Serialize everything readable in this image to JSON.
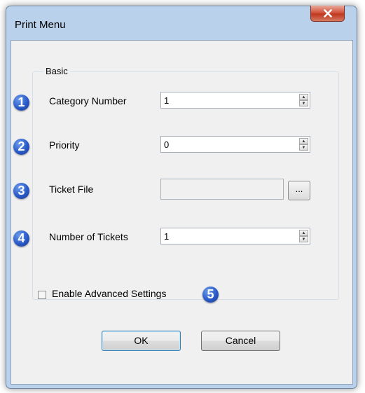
{
  "window": {
    "title": "Print Menu",
    "close_glyph": "X"
  },
  "group": {
    "label": "Basic"
  },
  "fields": {
    "category": {
      "badge": "1",
      "label": "Category Number",
      "value": "1"
    },
    "priority": {
      "badge": "2",
      "label": "Priority",
      "value": "0"
    },
    "ticket_file": {
      "badge": "3",
      "label": "Ticket File",
      "value": "",
      "browse_label": "..."
    },
    "num_tickets": {
      "badge": "4",
      "label": "Number of Tickets",
      "value": "1"
    }
  },
  "advanced": {
    "badge": "5",
    "label": "Enable Advanced Settings",
    "checked": false
  },
  "buttons": {
    "ok": "OK",
    "cancel": "Cancel"
  },
  "icons": {
    "badge": "numbered-circle-icon",
    "close": "close-x-icon",
    "spin": "spin-arrows-icon"
  },
  "colors": {
    "badge": "#2a5ac8",
    "close_button": "#c0381f",
    "frame": "#b9d1ea",
    "client": "#f0f0f0"
  }
}
